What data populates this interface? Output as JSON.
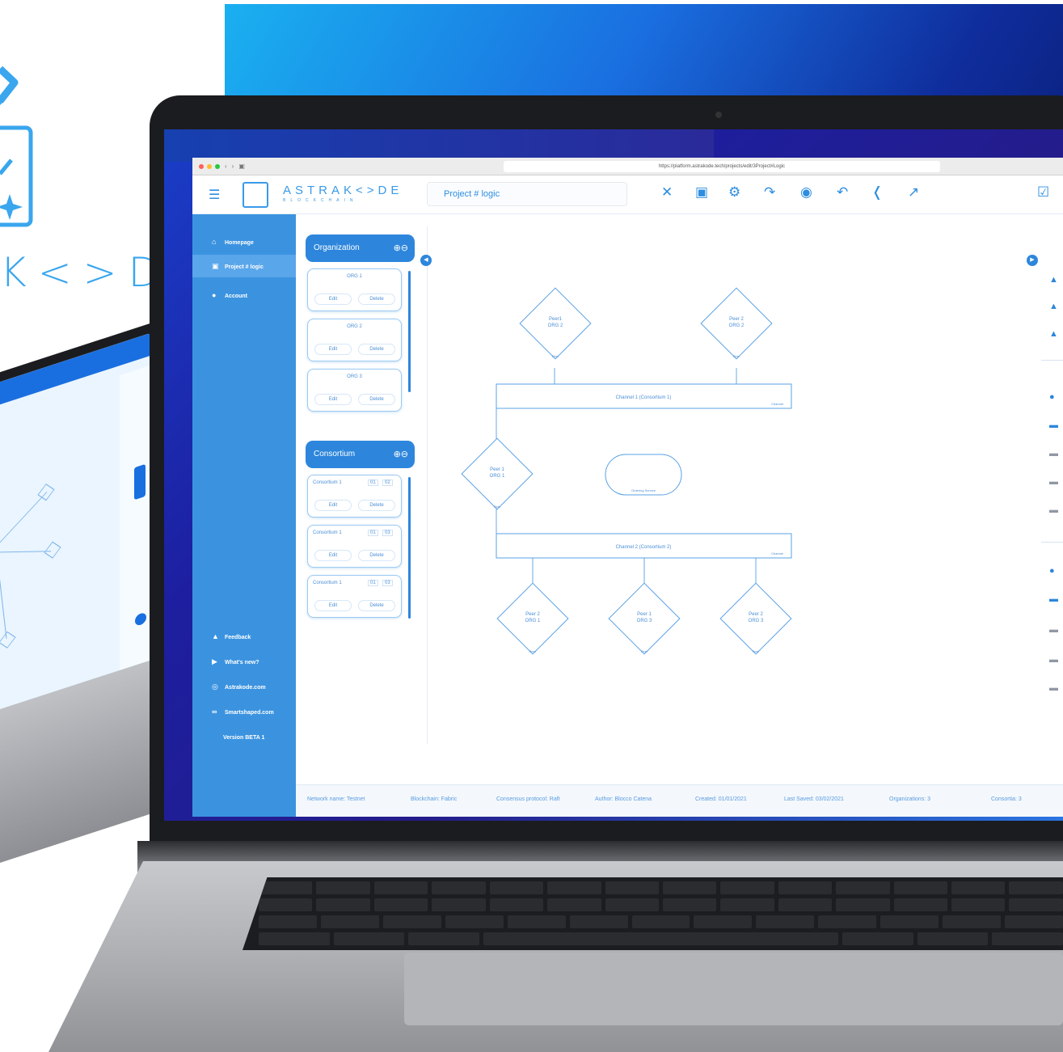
{
  "brand": {
    "wordmark": "K<>DE",
    "accent": "#3aa6ee"
  },
  "browser": {
    "url": "https://platform.astrakode.tech/projects/edit/3Project#Logic",
    "back_icon": "chevron-left-icon",
    "forward_icon": "chevron-right-icon"
  },
  "header": {
    "menu_icon": "hamburger-icon",
    "logo_word": "ASTRAK<>DE",
    "logo_sub": "BLOCKCHAIN",
    "project_name": "Project # logic",
    "tools": [
      "close-icon",
      "save-icon",
      "settings-icon",
      "redo-icon",
      "preview-icon",
      "undo-icon",
      "share-icon",
      "open-external-icon"
    ]
  },
  "sidebar": {
    "items": [
      {
        "label": "Homepage",
        "icon": "home-icon"
      },
      {
        "label": "Project # logic",
        "icon": "project-icon"
      },
      {
        "label": "Account",
        "icon": "account-icon"
      }
    ],
    "bottom": [
      {
        "label": "Feedback",
        "icon": "thumbs-up-icon"
      },
      {
        "label": "What's new?",
        "icon": "megaphone-icon"
      },
      {
        "label": "Astrakode.com",
        "icon": "globe-icon"
      },
      {
        "label": "Smartshaped.com",
        "icon": "infinity-icon"
      }
    ],
    "version": "Version BETA 1"
  },
  "organization": {
    "title": "Organization",
    "cards": [
      {
        "name": "ORG 1",
        "edit": "Edit",
        "delete": "Delete"
      },
      {
        "name": "ORG 2",
        "edit": "Edit",
        "delete": "Delete"
      },
      {
        "name": "ORG 3",
        "edit": "Edit",
        "delete": "Delete"
      }
    ]
  },
  "consortium": {
    "title": "Consortium",
    "cards": [
      {
        "name": "Consortium 1",
        "tag_a": "01",
        "tag_b": "02",
        "edit": "Edit",
        "delete": "Delete"
      },
      {
        "name": "Consortium 1",
        "tag_a": "01",
        "tag_b": "03",
        "edit": "Edit",
        "delete": "Delete"
      },
      {
        "name": "Consortium 1",
        "tag_a": "01",
        "tag_b": "03",
        "edit": "Edit",
        "delete": "Delete"
      }
    ]
  },
  "diagram": {
    "peers_top": [
      {
        "line1": "Peer1",
        "line2": "ORG 2"
      },
      {
        "line1": "Peer 2",
        "line2": "ORG 2"
      }
    ],
    "peer_mid": {
      "line1": "Peer 1",
      "line2": "ORG 1"
    },
    "peers_bottom": [
      {
        "line1": "Peer 2",
        "line2": "ORG 1"
      },
      {
        "line1": "Peer 1",
        "line2": "ORG 3"
      },
      {
        "line1": "Peer 2",
        "line2": "ORG 3"
      }
    ],
    "channel1": "Channel 1 (Consortium 1)",
    "channel2": "Channel 2 (Consortium 2)",
    "channel_tag": "Channel",
    "ordering": "Ordering Service",
    "peer_tag": "Peer"
  },
  "status": {
    "network": "Network name: Testnet",
    "blockchain": "Blockchain: Fabric",
    "consensus": "Consensus protocol: Raft",
    "author": "Author: Blocco Catena",
    "created": "Created: 01/01/2021",
    "saved": "Last Saved: 03/02/2021",
    "organizations": "Organizations: 3",
    "consortia": "Consortia: 3"
  }
}
